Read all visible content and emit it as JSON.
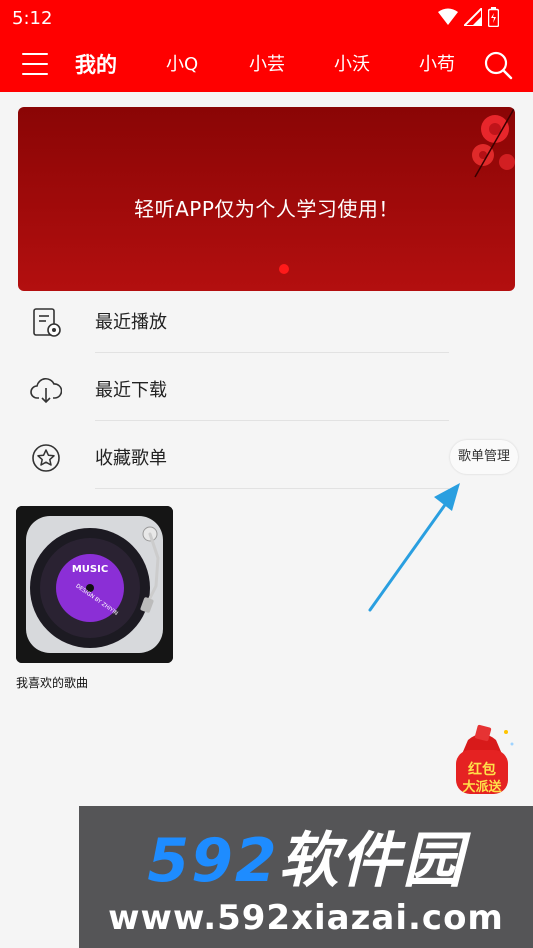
{
  "status_bar": {
    "time": "5:12"
  },
  "header": {
    "tabs": [
      {
        "label": "我的",
        "active": true
      },
      {
        "label": "小Q",
        "active": false
      },
      {
        "label": "小芸",
        "active": false
      },
      {
        "label": "小沃",
        "active": false
      },
      {
        "label": "小苟",
        "active": false
      }
    ]
  },
  "banner": {
    "text": "轻听APP仅为个人学习使用！"
  },
  "menu_list": [
    {
      "label": "最近播放",
      "icon": "recent-play-icon"
    },
    {
      "label": "最近下载",
      "icon": "cloud-download-icon"
    },
    {
      "label": "收藏歌单",
      "icon": "star-icon"
    }
  ],
  "playlist_manage": {
    "label": "歌单管理"
  },
  "playlist_cover": {
    "line1": "MUSIC",
    "line2": "DESIGN BY ZHIYIN"
  },
  "playlist": {
    "title": "我喜欢的歌曲"
  },
  "red_packet": {
    "line1": "红包",
    "line2": "大派送"
  },
  "watermark": {
    "logo_num": "592",
    "logo_text": "软件园",
    "url": "www.592xiazai.com"
  },
  "colors": {
    "primary": "#ff0000",
    "banner": "#a50c0c",
    "arrow": "#2a9fe0"
  }
}
